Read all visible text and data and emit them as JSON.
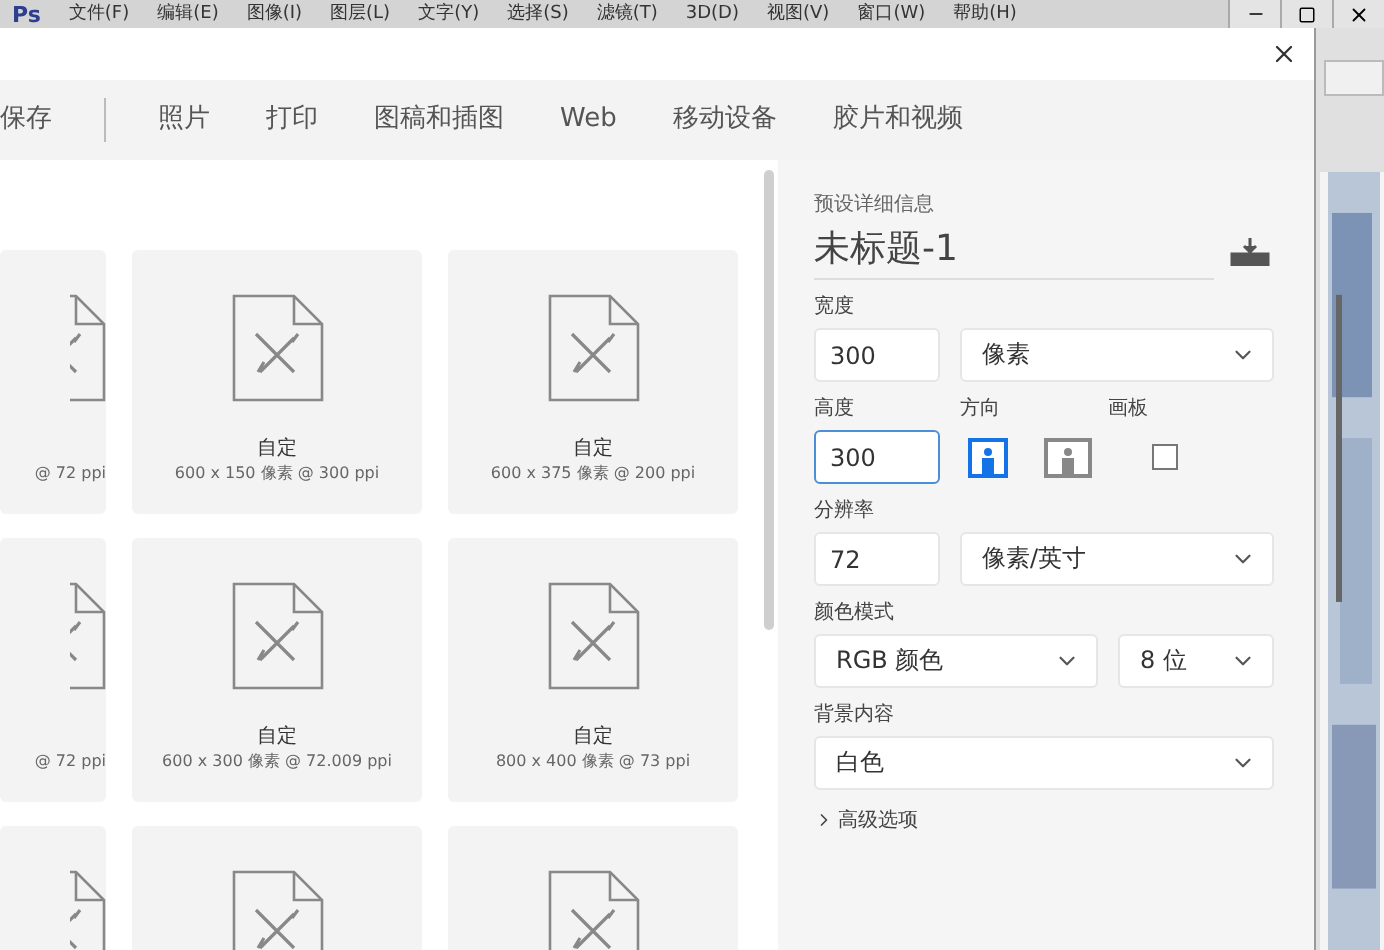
{
  "app": {
    "logo": "Ps",
    "menu": [
      "文件(F)",
      "编辑(E)",
      "图像(I)",
      "图层(L)",
      "文字(Y)",
      "选择(S)",
      "滤镜(T)",
      "3D(D)",
      "视图(V)",
      "窗口(W)",
      "帮助(H)"
    ]
  },
  "tabs": [
    {
      "label": "保存",
      "selected": false
    },
    {
      "label": "照片",
      "selected": false
    },
    {
      "label": "打印",
      "selected": false
    },
    {
      "label": "图稿和插图",
      "selected": false
    },
    {
      "label": "Web",
      "selected": false
    },
    {
      "label": "移动设备",
      "selected": false
    },
    {
      "label": "胶片和视频",
      "selected": false
    }
  ],
  "preset_rows": [
    [
      {
        "kind": "cut",
        "size": "@ 72 ppi"
      },
      {
        "kind": "full",
        "name": "自定",
        "size": "600 x 150 像素 @ 300 ppi"
      },
      {
        "kind": "full",
        "name": "自定",
        "size": "600 x 375 像素 @ 200 ppi"
      }
    ],
    [
      {
        "kind": "cut",
        "size": "@ 72 ppi"
      },
      {
        "kind": "full",
        "name": "自定",
        "size": "600 x 300 像素 @ 72.009 ppi"
      },
      {
        "kind": "full",
        "name": "自定",
        "size": "800 x 400 像素 @ 73 ppi"
      }
    ],
    [
      {
        "kind": "cut"
      },
      {
        "kind": "full"
      },
      {
        "kind": "full"
      }
    ]
  ],
  "details": {
    "heading": "预设详细信息",
    "title": "未标题-1",
    "width": {
      "label": "宽度",
      "value": "300",
      "unit": "像素"
    },
    "height": {
      "label": "高度",
      "value": "300",
      "focused": true
    },
    "orientation": {
      "label": "方向",
      "options": [
        {
          "kind": "portrait",
          "selected": true
        },
        {
          "kind": "landscape",
          "selected": false
        }
      ]
    },
    "artboard": {
      "label": "画板",
      "checked": false
    },
    "resolution": {
      "label": "分辨率",
      "value": "72",
      "unit": "像素/英寸"
    },
    "color_mode": {
      "label": "颜色模式",
      "mode": "RGB 颜色",
      "depth": "8 位"
    },
    "background": {
      "label": "背景内容",
      "value": "白色"
    },
    "advanced": {
      "label": "高级选项",
      "expanded": false
    }
  }
}
